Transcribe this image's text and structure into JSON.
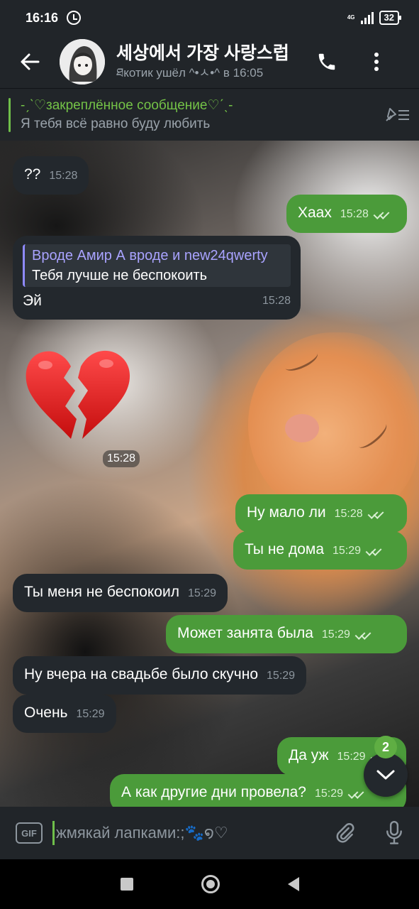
{
  "status_bar": {
    "time": "16:16",
    "network": "4G",
    "battery": "32"
  },
  "header": {
    "title": "세상에서 가장 사랑스럽",
    "status": "ཐкотик ушёл ^•ㅅ•^ в 16:05",
    "back_icon": "arrow-left-icon",
    "call_icon": "phone-icon",
    "menu_icon": "more-vertical-icon"
  },
  "pinned": {
    "title": "-ˏˋ♡закреплённое сообщение♡ˊˎ-",
    "text": "Я тебя всё равно буду любить"
  },
  "messages": [
    {
      "dir": "in",
      "text": "??",
      "time": "15:28"
    },
    {
      "dir": "out",
      "text": "Хаах",
      "time": "15:28"
    },
    {
      "dir": "in",
      "reply_name": "Вроде Амир А вроде и new24qwerty",
      "reply_text": "Тебя лучше не беспокоить",
      "text": "Эй",
      "time": "15:28"
    },
    {
      "dir": "in",
      "sticker": "broken-heart",
      "time": "15:28"
    },
    {
      "dir": "out",
      "text": "Ну мало ли",
      "time": "15:28"
    },
    {
      "dir": "out",
      "text": "Ты не дома",
      "time": "15:29"
    },
    {
      "dir": "in",
      "text": "Ты меня не беспокоил",
      "time": "15:29"
    },
    {
      "dir": "out",
      "text": "Может занята была",
      "time": "15:29"
    },
    {
      "dir": "in",
      "text": "Ну вчера на свадьбе было скучно",
      "time": "15:29"
    },
    {
      "dir": "in",
      "text": "Очень",
      "time": "15:29"
    },
    {
      "dir": "out",
      "text": "Да уж",
      "time": "15:29"
    },
    {
      "dir": "out",
      "text": "А как другие дни провела?",
      "time": "15:29"
    }
  ],
  "scroll_badge": "2",
  "input": {
    "placeholder": "жмякай лапками:;🐾໑♡",
    "gif_label": "GIF",
    "attach_icon": "paperclip-icon",
    "mic_icon": "microphone-icon"
  },
  "colors": {
    "accent": "#74c347",
    "outgoing_bubble": "#4b9b3a",
    "incoming_bubble": "#23282d",
    "reply_name": "#a9a3ff"
  }
}
